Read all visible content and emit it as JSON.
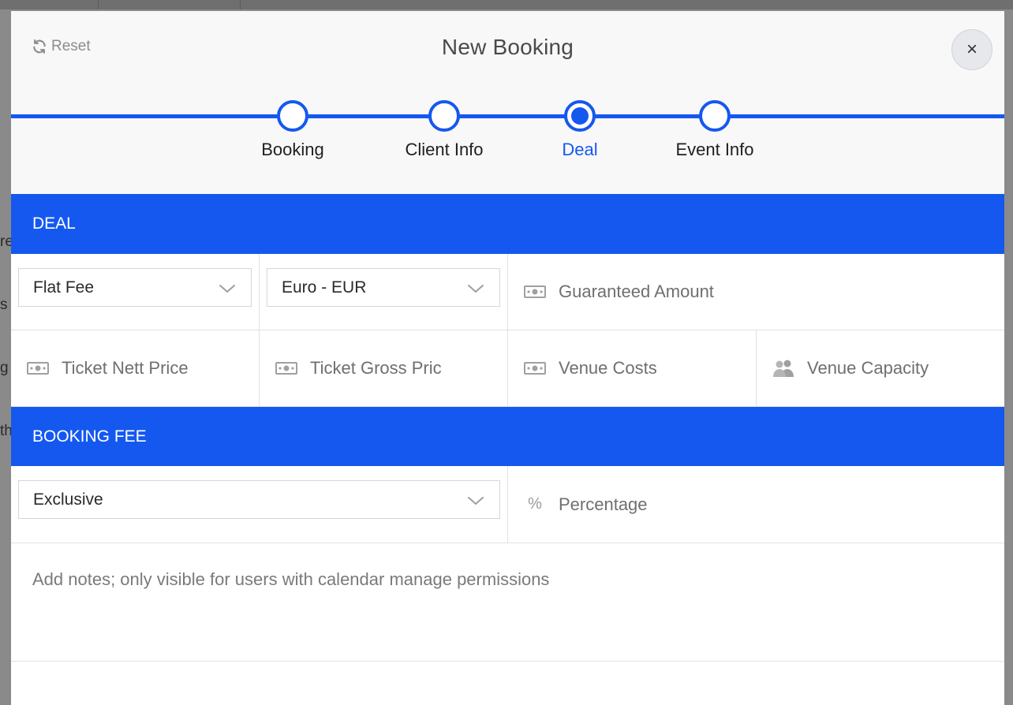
{
  "modal": {
    "title": "New Booking",
    "reset_label": "Reset",
    "close_label": "×"
  },
  "steps": [
    {
      "label": "Booking",
      "active": false
    },
    {
      "label": "Client Info",
      "active": false
    },
    {
      "label": "Deal",
      "active": true
    },
    {
      "label": "Event Info",
      "active": false
    }
  ],
  "deal": {
    "section_title": "DEAL",
    "deal_type": "Flat Fee",
    "currency": "Euro - EUR",
    "guaranteed_amount_placeholder": "Guaranteed Amount",
    "ticket_nett_price_placeholder": "Ticket Nett Price",
    "ticket_gross_price_placeholder": "Ticket Gross Pric",
    "venue_costs_placeholder": "Venue Costs",
    "venue_capacity_placeholder": "Venue Capacity"
  },
  "booking_fee": {
    "section_title": "BOOKING FEE",
    "fee_type": "Exclusive",
    "percentage_symbol": "%",
    "percentage_placeholder": "Percentage"
  },
  "notes": {
    "placeholder": "Add notes; only visible for users with calendar manage permissions"
  },
  "background": {
    "fragments": [
      "re",
      "s",
      "g",
      "th"
    ]
  },
  "colors": {
    "accent": "#1558f0",
    "header_bg": "#f8f8f8",
    "border": "#e2e2e2",
    "placeholder_text": "#6f6f6f"
  },
  "icons": {
    "reset": "refresh-icon",
    "close": "close-icon",
    "money": "banknote-icon",
    "capacity": "users-icon",
    "dropdown": "chevron-down-icon"
  }
}
